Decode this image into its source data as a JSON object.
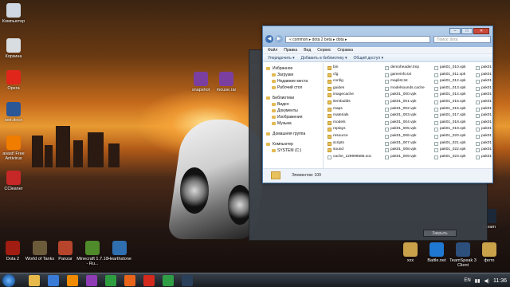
{
  "desktop": {
    "icons_left": [
      {
        "label": "Компьютер",
        "color": "#cfd8e3"
      },
      {
        "label": "Корзина",
        "color": "#d8dde2"
      },
      {
        "label": "Opera",
        "color": "#e0261b"
      },
      {
        "label": "wot.docx",
        "color": "#2b5797"
      },
      {
        "label": "avast! Free Antivirus",
        "color": "#f07c00"
      },
      {
        "label": "CCleaner",
        "color": "#c62828"
      }
    ],
    "icons_bottom": [
      {
        "label": "Dota 2",
        "color": "#a11d12"
      },
      {
        "label": "World of Tanks",
        "color": "#6b5b3a"
      },
      {
        "label": "Panzar",
        "color": "#b6452c"
      },
      {
        "label": "Minecraft 1.7.10 - Ru...",
        "color": "#4f8a2b"
      },
      {
        "label": "Hearthstone",
        "color": "#2f6fb0"
      }
    ],
    "icons_mid": [
      {
        "label": "snapshot",
        "color": "#7b3fa0"
      },
      {
        "label": "mouse.rar",
        "color": "#7b3fa0"
      }
    ],
    "icons_right": [
      {
        "label": "Steam",
        "color": "#1b2838"
      },
      {
        "label": "xxx",
        "color": "#c9a24a"
      },
      {
        "label": "Battle.net",
        "color": "#1f78d1"
      },
      {
        "label": "TeamSpeak 3 Client",
        "color": "#2c4f7c"
      },
      {
        "label": "фото",
        "color": "#c9a24a"
      }
    ]
  },
  "background_window": {
    "button_label": "Закрыть"
  },
  "explorer": {
    "nav_back": "◀",
    "nav_forward": "▶",
    "address": "«  common  ▸  dota 2 beta  ▸  dota  ▸",
    "search_placeholder": "Поиск: dota",
    "window_buttons": {
      "minimize": "–",
      "maximize": "□",
      "close": "✕"
    },
    "menu": [
      "Файл",
      "Правка",
      "Вид",
      "Сервис",
      "Справка"
    ],
    "toolbar": [
      "Упорядочить ▾",
      "Добавить в библиотеку ▾",
      "Общий доступ ▾"
    ],
    "nav_pane": [
      {
        "label": "Избранное",
        "child": false
      },
      {
        "label": "Загрузки",
        "child": true
      },
      {
        "label": "Недавние места",
        "child": true
      },
      {
        "label": "Рабочий стол",
        "child": true
      },
      {
        "label": "",
        "child": false,
        "gap": true
      },
      {
        "label": "Библиотеки",
        "child": false
      },
      {
        "label": "Видео",
        "child": true
      },
      {
        "label": "Документы",
        "child": true
      },
      {
        "label": "Изображения",
        "child": true
      },
      {
        "label": "Музыка",
        "child": true
      },
      {
        "label": "",
        "child": false,
        "gap": true
      },
      {
        "label": "Домашняя группа",
        "child": false
      },
      {
        "label": "",
        "child": false,
        "gap": true
      },
      {
        "label": "Компьютер",
        "child": false
      },
      {
        "label": "SYSTEM (C:)",
        "child": true
      }
    ],
    "columns": [
      [
        {
          "name": "bin",
          "folder": true
        },
        {
          "name": "cfg",
          "folder": true
        },
        {
          "name": "config",
          "folder": true
        },
        {
          "name": "guides",
          "folder": true
        },
        {
          "name": "imagecache",
          "folder": true
        },
        {
          "name": "itembuilds",
          "folder": true
        },
        {
          "name": "maps",
          "folder": true
        },
        {
          "name": "materials",
          "folder": true
        },
        {
          "name": "models",
          "folder": true
        },
        {
          "name": "replays",
          "folder": true
        },
        {
          "name": "resource",
          "folder": true
        },
        {
          "name": "scripts",
          "folder": true
        },
        {
          "name": "sound",
          "folder": true
        },
        {
          "name": "cache_129999585.soc",
          "folder": false
        }
      ],
      [
        {
          "name": "demoheader.tmp",
          "folder": false
        },
        {
          "name": "gameinfo.txt",
          "folder": false
        },
        {
          "name": "maplist.txt",
          "folder": false
        },
        {
          "name": "modelsounds.cache",
          "folder": false
        },
        {
          "name": "pak01_000.vpk",
          "folder": false
        },
        {
          "name": "pak01_001.vpk",
          "folder": false
        },
        {
          "name": "pak01_002.vpk",
          "folder": false
        },
        {
          "name": "pak01_003.vpk",
          "folder": false
        },
        {
          "name": "pak01_004.vpk",
          "folder": false
        },
        {
          "name": "pak01_005.vpk",
          "folder": false
        },
        {
          "name": "pak01_006.vpk",
          "folder": false
        },
        {
          "name": "pak01_007.vpk",
          "folder": false
        },
        {
          "name": "pak01_008.vpk",
          "folder": false
        },
        {
          "name": "pak01_009.vpk",
          "folder": false
        }
      ],
      [
        {
          "name": "pak01_010.vpk",
          "folder": false
        },
        {
          "name": "pak01_011.vpk",
          "folder": false
        },
        {
          "name": "pak01_012.vpk",
          "folder": false
        },
        {
          "name": "pak01_013.vpk",
          "folder": false
        },
        {
          "name": "pak01_014.vpk",
          "folder": false
        },
        {
          "name": "pak01_015.vpk",
          "folder": false
        },
        {
          "name": "pak01_016.vpk",
          "folder": false
        },
        {
          "name": "pak01_017.vpk",
          "folder": false
        },
        {
          "name": "pak01_018.vpk",
          "folder": false
        },
        {
          "name": "pak01_019.vpk",
          "folder": false
        },
        {
          "name": "pak01_020.vpk",
          "folder": false
        },
        {
          "name": "pak01_021.vpk",
          "folder": false
        },
        {
          "name": "pak01_022.vpk",
          "folder": false
        },
        {
          "name": "pak01_023.vpk",
          "folder": false
        }
      ],
      [
        {
          "name": "pak01",
          "folder": false
        },
        {
          "name": "pak01",
          "folder": false
        },
        {
          "name": "pak01",
          "folder": false
        },
        {
          "name": "pak01",
          "folder": false
        },
        {
          "name": "pak01",
          "folder": false
        },
        {
          "name": "pak01",
          "folder": false
        },
        {
          "name": "pak01",
          "folder": false
        },
        {
          "name": "pak01",
          "folder": false
        },
        {
          "name": "pak01",
          "folder": false
        },
        {
          "name": "pak01",
          "folder": false
        },
        {
          "name": "pak01",
          "folder": false
        },
        {
          "name": "pak01",
          "folder": false
        },
        {
          "name": "pak01",
          "folder": false
        },
        {
          "name": "pak01",
          "folder": false
        }
      ]
    ],
    "status": "Элементов: 109"
  },
  "taskbar": {
    "icons": [
      {
        "name": "explorer-icon",
        "color": "#e6b94a"
      },
      {
        "name": "media-player-icon",
        "color": "#3a7bd5"
      },
      {
        "name": "vlc-icon",
        "color": "#f08a00"
      },
      {
        "name": "bandicam-icon",
        "color": "#8e3bb5"
      },
      {
        "name": "utorrent-icon",
        "color": "#2e9d3f"
      },
      {
        "name": "firefox-icon",
        "color": "#e8641b"
      },
      {
        "name": "opera-icon",
        "color": "#d42a1e"
      },
      {
        "name": "chrome-icon",
        "color": "#2f9e44"
      },
      {
        "name": "steam-icon",
        "color": "#2a3f5a"
      }
    ],
    "lang": "EN",
    "time": "11:36"
  }
}
